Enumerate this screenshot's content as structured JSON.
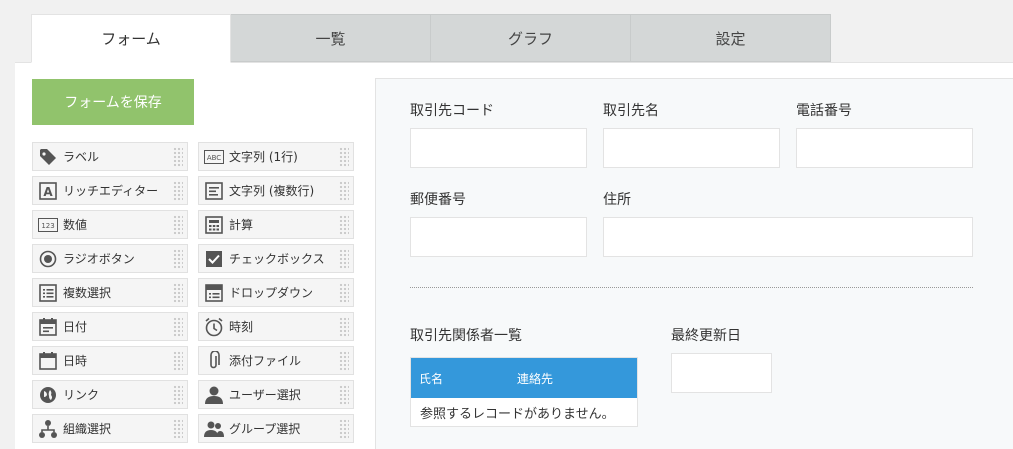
{
  "tabs": [
    "フォーム",
    "一覧",
    "グラフ",
    "設定"
  ],
  "save_button": "フォームを保存",
  "palette": [
    {
      "label": "ラベル",
      "icon": "tag-icon"
    },
    {
      "label": "文字列 (1行)",
      "icon": "abc-text-icon"
    },
    {
      "label": "リッチエディター",
      "icon": "rich-editor-icon"
    },
    {
      "label": "文字列 (複数行)",
      "icon": "multiline-text-icon"
    },
    {
      "label": "数値",
      "icon": "number-icon"
    },
    {
      "label": "計算",
      "icon": "calculator-icon"
    },
    {
      "label": "ラジオボタン",
      "icon": "radio-icon"
    },
    {
      "label": "チェックボックス",
      "icon": "checkbox-icon"
    },
    {
      "label": "複数選択",
      "icon": "multi-select-icon"
    },
    {
      "label": "ドロップダウン",
      "icon": "dropdown-icon"
    },
    {
      "label": "日付",
      "icon": "date-icon"
    },
    {
      "label": "時刻",
      "icon": "clock-icon"
    },
    {
      "label": "日時",
      "icon": "datetime-icon"
    },
    {
      "label": "添付ファイル",
      "icon": "paperclip-icon"
    },
    {
      "label": "リンク",
      "icon": "globe-icon"
    },
    {
      "label": "ユーザー選択",
      "icon": "user-icon"
    },
    {
      "label": "組織選択",
      "icon": "org-icon"
    },
    {
      "label": "グループ選択",
      "icon": "group-icon"
    }
  ],
  "form": {
    "customer_code": "取引先コード",
    "customer_name": "取引先名",
    "phone": "電話番号",
    "postal_code": "郵便番号",
    "address": "住所",
    "contacts_label": "取引先関係者一覧",
    "last_updated": "最終更新日",
    "table_cols": [
      "氏名",
      "連絡先"
    ],
    "table_empty": "参照するレコードがありません。"
  },
  "colors": {
    "accent": "#3498db",
    "save": "#91c36c"
  }
}
